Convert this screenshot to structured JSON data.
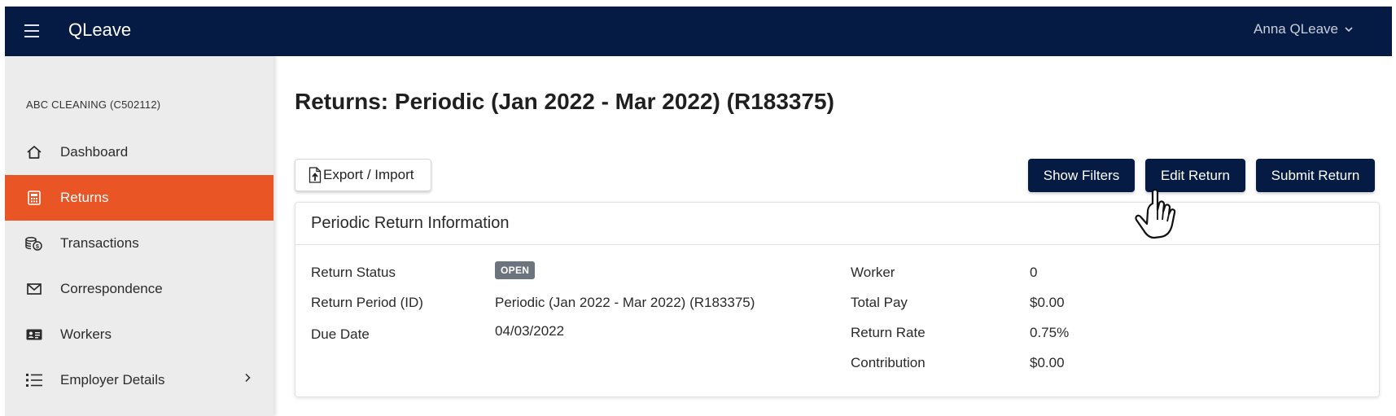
{
  "topbar": {
    "app_title": "QLeave",
    "user_name": "Anna QLeave"
  },
  "sidebar": {
    "employer": "ABC CLEANING (C502112)",
    "items": [
      {
        "label": "Dashboard",
        "icon": "home-icon",
        "active": false
      },
      {
        "label": "Returns",
        "icon": "calculator-icon",
        "active": true
      },
      {
        "label": "Transactions",
        "icon": "coins-icon",
        "active": false
      },
      {
        "label": "Correspondence",
        "icon": "envelope-icon",
        "active": false
      },
      {
        "label": "Workers",
        "icon": "id-card-icon",
        "active": false
      },
      {
        "label": "Employer Details",
        "icon": "list-icon",
        "active": false,
        "has_submenu": true
      }
    ]
  },
  "main": {
    "title": "Returns: Periodic (Jan 2022 - Mar 2022) (R183375)",
    "buttons": {
      "export_import": "Export / Import",
      "show_filters": "Show Filters",
      "edit_return": "Edit Return",
      "submit_return": "Submit Return"
    },
    "card": {
      "title": "Periodic Return Information",
      "left": [
        {
          "label": "Return Status",
          "value": "OPEN"
        },
        {
          "label": "Return Period (ID)",
          "value": "Periodic (Jan 2022 - Mar 2022) (R183375)"
        },
        {
          "label": "Due Date",
          "value": "04/03/2022"
        }
      ],
      "right": [
        {
          "label": "Worker",
          "value": "0"
        },
        {
          "label": "Total Pay",
          "value": "$0.00"
        },
        {
          "label": "Return Rate",
          "value": "0.75%"
        },
        {
          "label": "Contribution",
          "value": "$0.00"
        }
      ]
    }
  },
  "colors": {
    "navy": "#051b44",
    "accent": "#ea5525",
    "badge": "#6c757d"
  }
}
